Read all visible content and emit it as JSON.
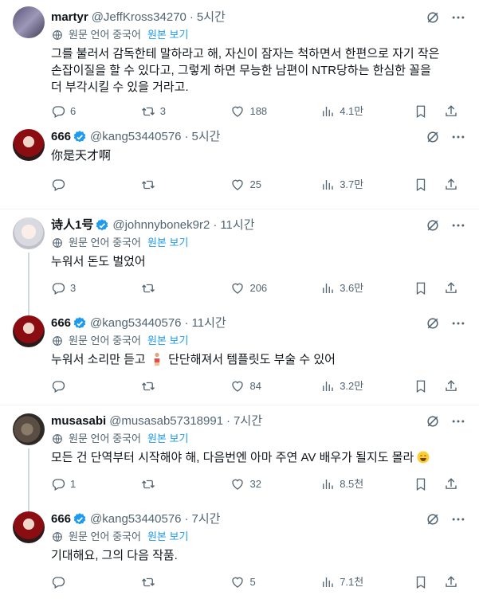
{
  "translate": {
    "label": "원문 언어 중국어",
    "show": "원본 보기"
  },
  "tweets": [
    {
      "name": "martyr",
      "handle": "@JeffKross34270",
      "time": "5시간",
      "translated": true,
      "verified": false,
      "text": "그를 불러서 감독한테 말하라고 해, 자신이 잠자는 척하면서 한편으로 자기 작은 손잡이질을 할 수 있다고, 그렇게 하면 무능한 남편이 NTR당하는 한심한 꼴을 더 부각시킬 수 있을 거라고.",
      "replies": "6",
      "retweets": "3",
      "likes": "188",
      "views": "4.1만"
    },
    {
      "name": "666",
      "handle": "@kang53440576",
      "time": "5시간",
      "translated": false,
      "verified": true,
      "text": "你是天才啊",
      "replies": "",
      "retweets": "",
      "likes": "25",
      "views": "3.7만"
    },
    {
      "name": "诗人1号",
      "handle": "@johnnybonek9r2",
      "time": "11시간",
      "translated": true,
      "verified": true,
      "text": "누워서 돈도 벌었어",
      "replies": "3",
      "retweets": "",
      "likes": "206",
      "views": "3.6만"
    },
    {
      "name": "666",
      "handle": "@kang53440576",
      "time": "11시간",
      "translated": true,
      "verified": true,
      "text_a": "누워서 소리만 듣고",
      "text_b": "단단해져서 템플릿도 부술 수 있어",
      "replies": "",
      "retweets": "",
      "likes": "84",
      "views": "3.2만"
    },
    {
      "name": "musasabi",
      "handle": "@musasab57318991",
      "time": "7시간",
      "translated": true,
      "verified": false,
      "text": "모든 건 단역부터 시작해야 해, 다음번엔 아마 주연 AV 배우가 될지도 몰라",
      "replies": "1",
      "retweets": "",
      "likes": "32",
      "views": "8.5천"
    },
    {
      "name": "666",
      "handle": "@kang53440576",
      "time": "7시간",
      "translated": true,
      "verified": true,
      "text": "기대해요, 그의 다음 작품.",
      "replies": "",
      "retweets": "",
      "likes": "5",
      "views": "7.1천"
    }
  ],
  "colors": {
    "text": "#0f1419",
    "secondary": "#536471",
    "link": "#1d9bf0",
    "verified": "#1d9bf0"
  },
  "icons": [
    "reply-icon",
    "retweet-icon",
    "like-icon",
    "views-icon",
    "bookmark-icon",
    "share-icon",
    "grok-icon",
    "more-icon",
    "verified-badge-icon",
    "translate-icon",
    "smile-emoji",
    "figure-emoji"
  ]
}
